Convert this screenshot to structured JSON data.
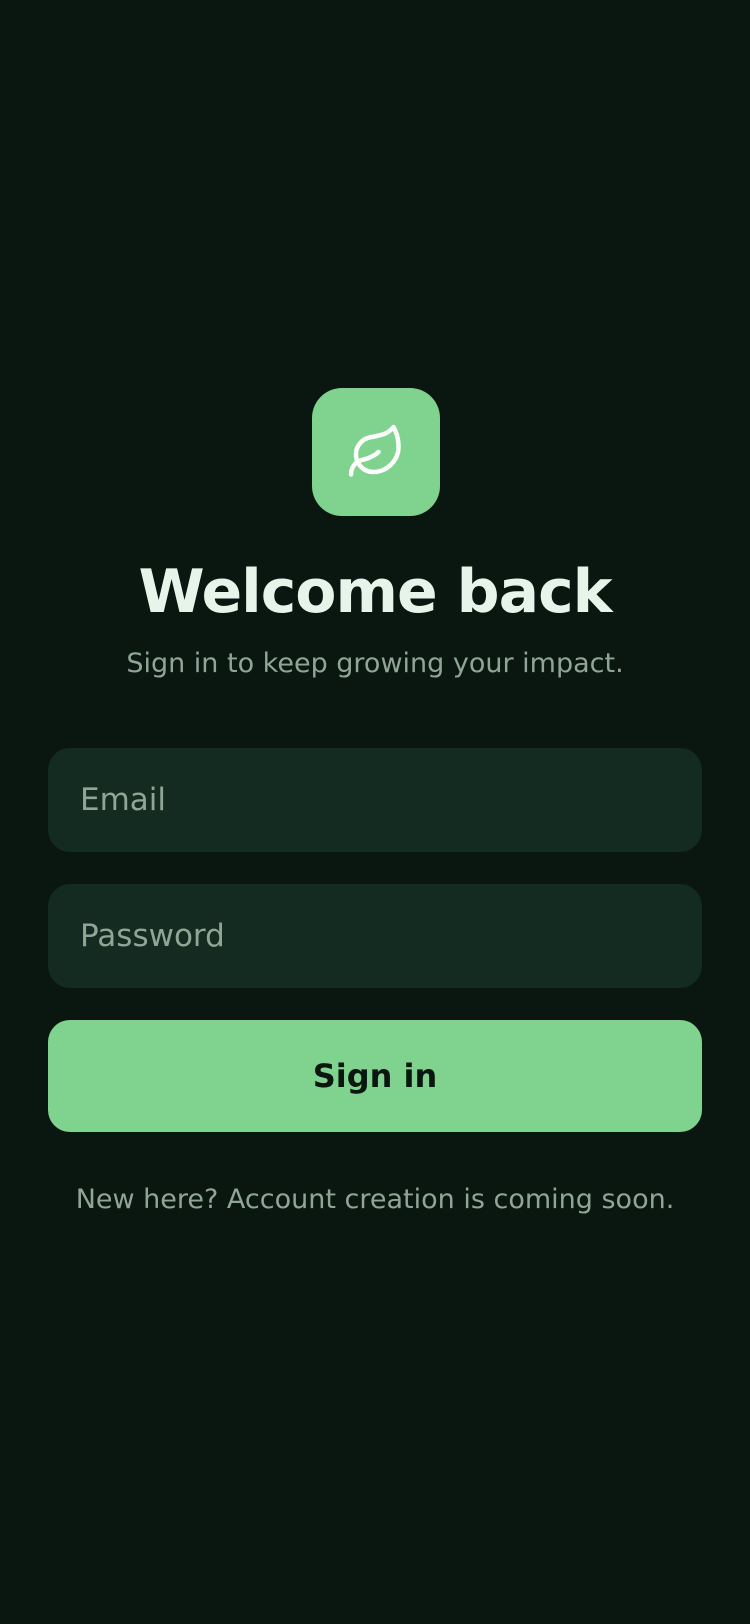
{
  "login": {
    "logo_icon": "leaf-icon",
    "title": "Welcome back",
    "subtitle": "Sign in to keep growing your impact.",
    "email": {
      "placeholder": "Email",
      "value": ""
    },
    "password": {
      "placeholder": "Password",
      "value": ""
    },
    "submit_label": "Sign in",
    "footer_text": "New here? Account creation is coming soon."
  },
  "colors": {
    "background": "#0a1711",
    "accent": "#7fd38e",
    "field": "#132b20",
    "title": "#e7f4ea",
    "muted": "#8fa596"
  }
}
